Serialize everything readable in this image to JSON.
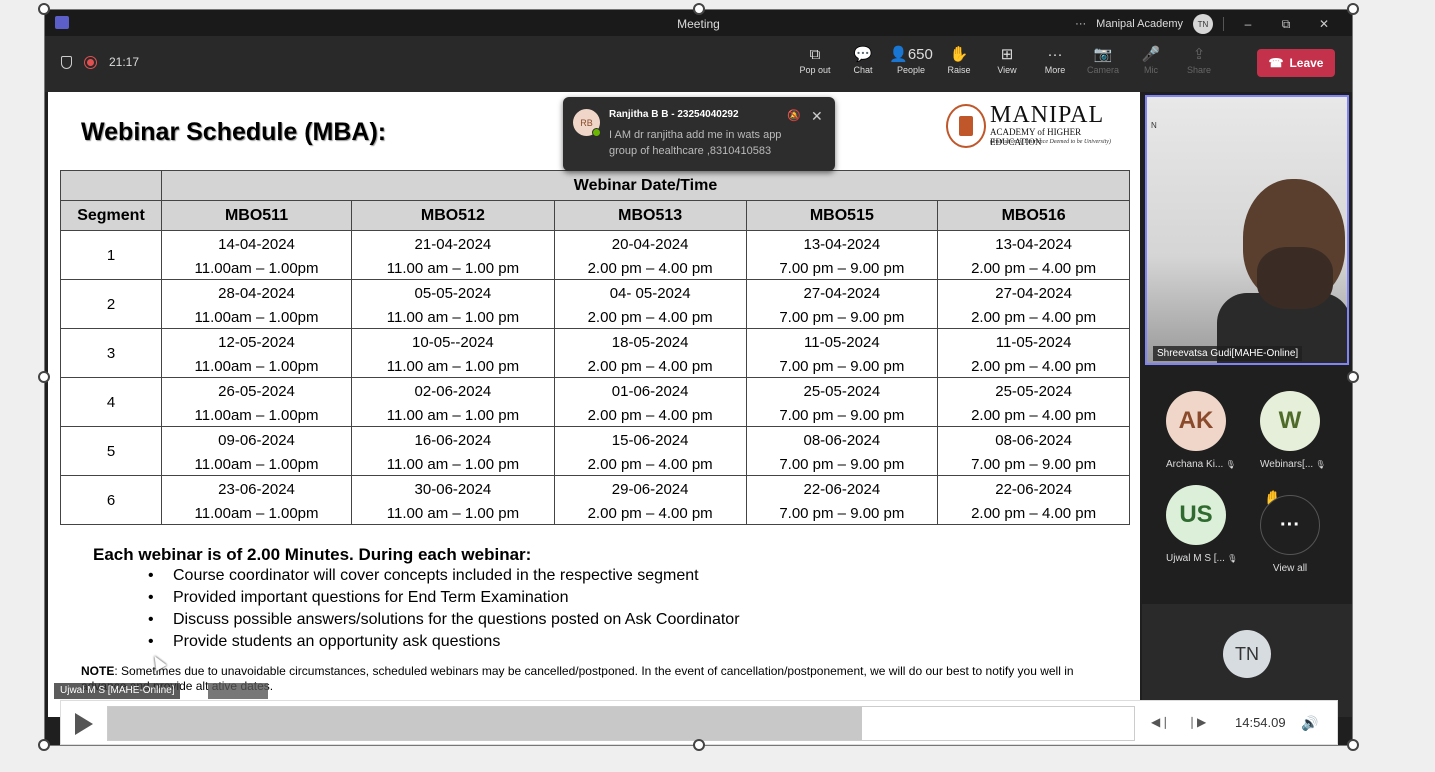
{
  "titlebar": {
    "title": "Meeting",
    "org": "Manipal Academy",
    "user_initials": "TN",
    "more": "···",
    "minimize": "–",
    "restore": "⧉",
    "close": "✕"
  },
  "toolbar": {
    "timer": "21:17",
    "buttons": [
      {
        "icon": "popout-icon",
        "glyph": "⧉",
        "label": "Pop out"
      },
      {
        "icon": "chat-icon",
        "glyph": "💬",
        "label": "Chat"
      },
      {
        "icon": "people-icon",
        "glyph": "👤650",
        "label": "People"
      },
      {
        "icon": "raise-hand-icon",
        "glyph": "✋",
        "label": "Raise"
      },
      {
        "icon": "view-icon",
        "glyph": "⊞",
        "label": "View"
      },
      {
        "icon": "more-icon",
        "glyph": "···",
        "label": "More"
      },
      {
        "icon": "camera-icon",
        "glyph": "📷",
        "label": "Camera"
      },
      {
        "icon": "mic-icon",
        "glyph": "🎤",
        "label": "Mic"
      },
      {
        "icon": "share-icon",
        "glyph": "⇪",
        "label": "Share"
      }
    ],
    "leave_label": "Leave"
  },
  "slide": {
    "title": "Webinar Schedule (MBA):",
    "logo": {
      "name": "MANIPAL",
      "line2": "ACADEMY of HIGHER EDUCATION",
      "line3": "(Institution of Eminence Deemed to be University)"
    },
    "table": {
      "super_header": "Webinar Date/Time",
      "segment_header": "Segment",
      "courses": [
        "MBO511",
        "MBO512",
        "MBO513",
        "MBO515",
        "MBO516"
      ],
      "rows": [
        {
          "segment": "1",
          "cells": [
            [
              "14-04-2024",
              "11.00am – 1.00pm"
            ],
            [
              "21-04-2024",
              "11.00 am – 1.00 pm"
            ],
            [
              "20-04-2024",
              "2.00 pm – 4.00 pm"
            ],
            [
              "13-04-2024",
              "7.00 pm – 9.00 pm"
            ],
            [
              "13-04-2024",
              "2.00 pm – 4.00 pm"
            ]
          ]
        },
        {
          "segment": "2",
          "cells": [
            [
              "28-04-2024",
              "11.00am – 1.00pm"
            ],
            [
              "05-05-2024",
              "11.00 am – 1.00 pm"
            ],
            [
              "04- 05-2024",
              "2.00 pm – 4.00 pm"
            ],
            [
              "27-04-2024",
              "7.00 pm – 9.00 pm"
            ],
            [
              "27-04-2024",
              "2.00 pm – 4.00 pm"
            ]
          ]
        },
        {
          "segment": "3",
          "cells": [
            [
              "12-05-2024",
              "11.00am – 1.00pm"
            ],
            [
              "10-05--2024",
              "11.00 am – 1.00 pm"
            ],
            [
              "18-05-2024",
              "2.00 pm – 4.00 pm"
            ],
            [
              "11-05-2024",
              "7.00 pm – 9.00 pm"
            ],
            [
              "11-05-2024",
              "2.00 pm – 4.00 pm"
            ]
          ]
        },
        {
          "segment": "4",
          "cells": [
            [
              "26-05-2024",
              "11.00am – 1.00pm"
            ],
            [
              "02-06-2024",
              "11.00 am – 1.00 pm"
            ],
            [
              "01-06-2024",
              "2.00 pm – 4.00 pm"
            ],
            [
              "25-05-2024",
              "7.00 pm – 9.00 pm"
            ],
            [
              "25-05-2024",
              "2.00 pm – 4.00 pm"
            ]
          ]
        },
        {
          "segment": "5",
          "cells": [
            [
              "09-06-2024",
              "11.00am – 1.00pm"
            ],
            [
              "16-06-2024",
              "11.00 am – 1.00 pm"
            ],
            [
              "15-06-2024",
              "2.00 pm – 4.00 pm"
            ],
            [
              "08-06-2024",
              "7.00 pm – 9.00 pm"
            ],
            [
              "08-06-2024",
              "7.00 pm – 9.00 pm"
            ]
          ]
        },
        {
          "segment": "6",
          "cells": [
            [
              "23-06-2024",
              "11.00am – 1.00pm"
            ],
            [
              "30-06-2024",
              "11.00 am – 1.00 pm"
            ],
            [
              "29-06-2024",
              "2.00 pm – 4.00 pm"
            ],
            [
              "22-06-2024",
              "7.00 pm – 9.00 pm"
            ],
            [
              "22-06-2024",
              "2.00 pm – 4.00 pm"
            ]
          ]
        }
      ]
    },
    "notes_heading": "Each webinar is of 2.00 Minutes. During each webinar:",
    "bullets": [
      "Course coordinator will cover concepts included in the respective segment",
      "Provided important questions for End Term Examination",
      "Discuss possible answers/solutions for the questions posted on Ask Coordinator",
      "Provide students an opportunity ask questions"
    ],
    "note_label": "NOTE",
    "note_text": ": Sometimes due to unavoidable circumstances, scheduled webinars may be cancelled/postponed. In the event of cancellation/postponement, we will do our best to notify you well in advance and provide alt   ative dates."
  },
  "toast": {
    "initials": "RB",
    "name": "Ranjitha B B - 23254040292",
    "message": "I AM dr ranjitha add me in wats app group of healthcare ,8310410583",
    "close": "✕"
  },
  "participants": {
    "speaker": "Shreevatsa Gudi[MAHE-Online]",
    "list": [
      {
        "initials": "AK",
        "name": "Archana Ki...",
        "bg": "#efd6c8",
        "fg": "#8a4a2b"
      },
      {
        "initials": "W",
        "name": "Webinars[...",
        "bg": "#e6efd9",
        "fg": "#4f6b2a"
      },
      {
        "initials": "US",
        "name": "Ujwal M S [...",
        "bg": "#dcefd8",
        "fg": "#2f6b30"
      }
    ],
    "view_all": "View all",
    "view_all_glyph": "···",
    "self_initials": "TN"
  },
  "caption": {
    "name": "Ujwal M S [MAHE-Online]"
  },
  "player": {
    "time": "14:54.09",
    "progress": 0.735
  }
}
